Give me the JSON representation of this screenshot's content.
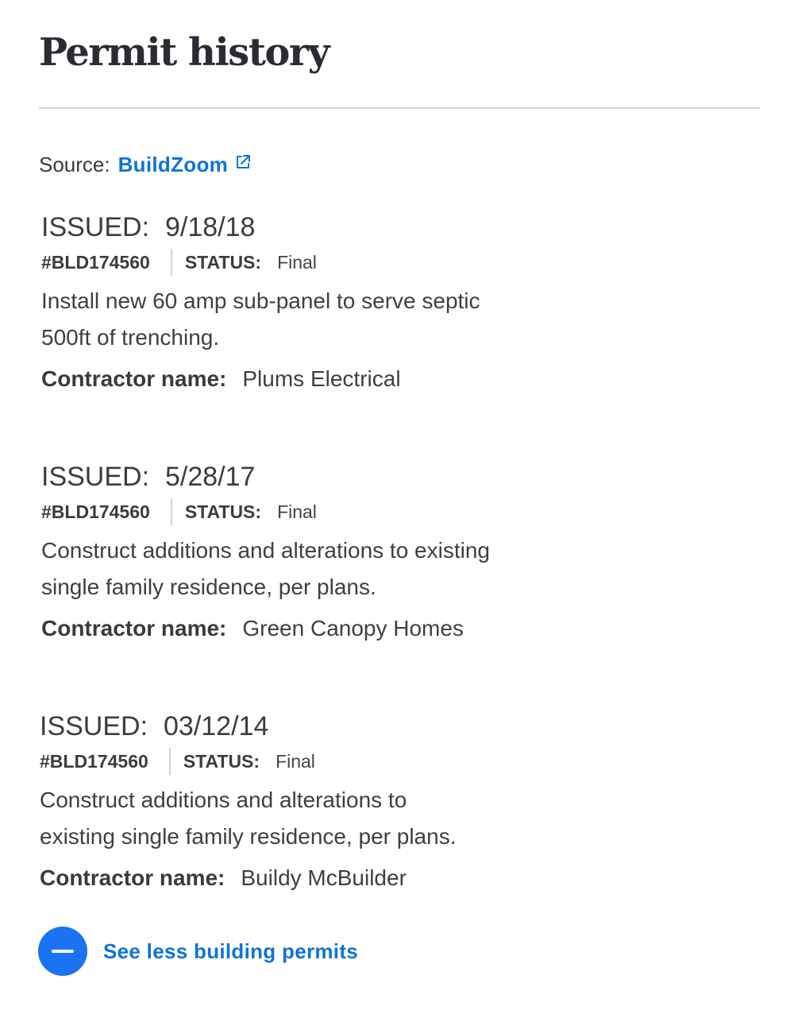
{
  "header": {
    "title": "Permit history"
  },
  "source": {
    "label": "Source:",
    "link_text": "BuildZoom",
    "icon": "external-link-icon"
  },
  "permits": [
    {
      "issued_label": "ISSUED:",
      "issued_date": "9/18/18",
      "number": "#BLD174560",
      "status_label": "STATUS:",
      "status": "Final",
      "description_line1": "Install new 60 amp sub-panel to serve septic",
      "description_line2": "500ft of trenching.",
      "contractor_label": "Contractor name:",
      "contractor": "Plums Electrical"
    },
    {
      "issued_label": "ISSUED:",
      "issued_date": "5/28/17",
      "number": "#BLD174560",
      "status_label": "STATUS:",
      "status": "Final",
      "description_line1": "Construct additions and alterations to existing",
      "description_line2": "single family residence, per plans.",
      "contractor_label": "Contractor name:",
      "contractor": "Green Canopy Homes"
    },
    {
      "issued_label": "ISSUED:",
      "issued_date": "03/12/14",
      "number": "#BLD174560",
      "status_label": "STATUS:",
      "status": "Final",
      "description_line1": "Construct additions and alterations to",
      "description_line2": "existing single family residence, per plans.",
      "contractor_label": "Contractor name:",
      "contractor": "Buildy McBuilder"
    }
  ],
  "toggle": {
    "label": "See less building permits",
    "icon": "minus-circle-icon"
  },
  "colors": {
    "link": "#0f73d9",
    "button": "#1a73f0",
    "text": "#3c3c3c",
    "title": "#2b2b33",
    "divider": "#d6d6d6"
  }
}
